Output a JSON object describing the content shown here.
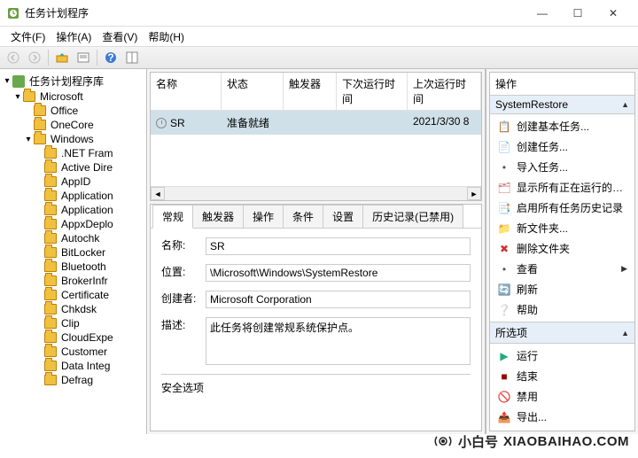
{
  "window": {
    "title": "任务计划程序"
  },
  "menubar": [
    "文件(F)",
    "操作(A)",
    "查看(V)",
    "帮助(H)"
  ],
  "tree": {
    "root": "任务计划程序库",
    "microsoft": "Microsoft",
    "children_l2": [
      "Office",
      "OneCore"
    ],
    "windows": "Windows",
    "win_children": [
      ".NET Fram",
      "Active Dire",
      "AppID",
      "Application",
      "Application",
      "AppxDeplo",
      "Autochk",
      "BitLocker",
      "Bluetooth",
      "BrokerInfr",
      "Certificate",
      "Chkdsk",
      "Clip",
      "CloudExpe",
      "Customer",
      "Data Integ",
      "Defrag"
    ]
  },
  "tasks": {
    "columns": {
      "name": "名称",
      "status": "状态",
      "triggers": "触发器",
      "next": "下次运行时间",
      "last": "上次运行时间"
    },
    "row": {
      "name": "SR",
      "status": "准备就绪",
      "triggers": "",
      "next": "",
      "last": "2021/3/30 8"
    }
  },
  "props": {
    "tabs": [
      "常规",
      "触发器",
      "操作",
      "条件",
      "设置",
      "历史记录(已禁用)"
    ],
    "name_label": "名称:",
    "name_value": "SR",
    "location_label": "位置:",
    "location_value": "\\Microsoft\\Windows\\SystemRestore",
    "author_label": "创建者:",
    "author_value": "Microsoft Corporation",
    "desc_label": "描述:",
    "desc_value": "此任务将创建常规系统保护点。",
    "security_label": "安全选项"
  },
  "actions": {
    "pane_title": "操作",
    "section1": "SystemRestore",
    "items1": [
      "创建基本任务...",
      "创建任务...",
      "导入任务...",
      "显示所有正在运行的任务",
      "启用所有任务历史记录",
      "新文件夹...",
      "删除文件夹",
      "查看",
      "刷新",
      "帮助"
    ],
    "section2": "所选项",
    "items2": [
      "运行",
      "结束",
      "禁用",
      "导出..."
    ]
  },
  "watermark": {
    "brand": "小白号",
    "url": "XIAOBAIHAO.COM"
  }
}
